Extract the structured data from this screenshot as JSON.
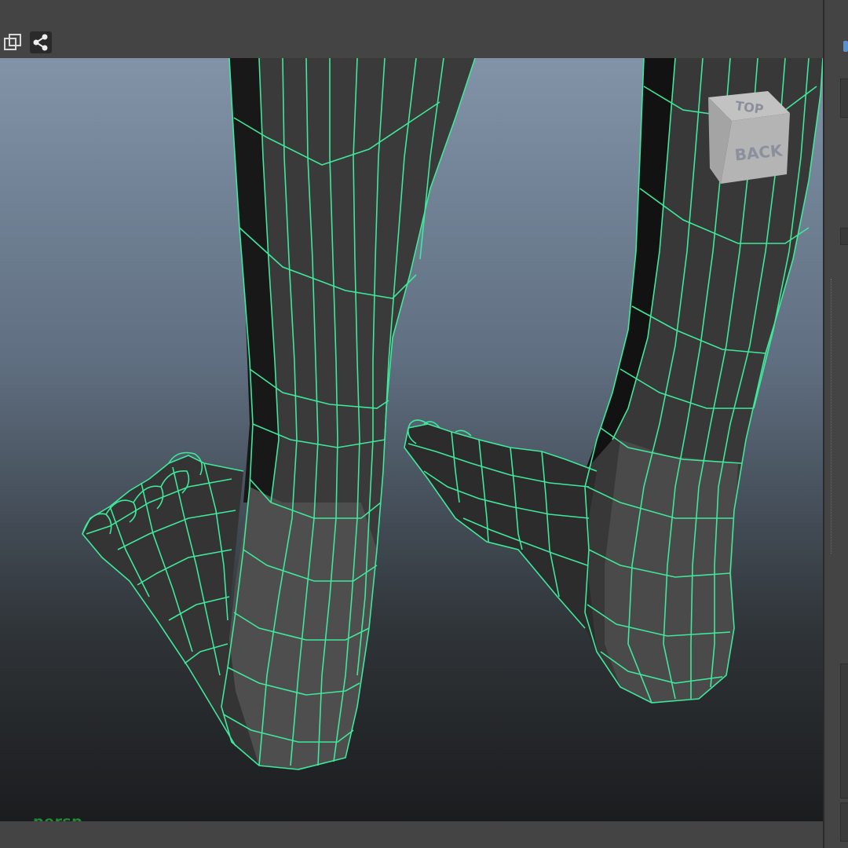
{
  "toolbar": {
    "buttons": [
      {
        "icon": "isolate-select-icon"
      },
      {
        "icon": "share-nodes-icon"
      }
    ]
  },
  "viewport": {
    "camera": "persp",
    "viewcube_face": "BACK",
    "viewcube_top_text": "TOP",
    "wire_color": "#3fe89a"
  }
}
